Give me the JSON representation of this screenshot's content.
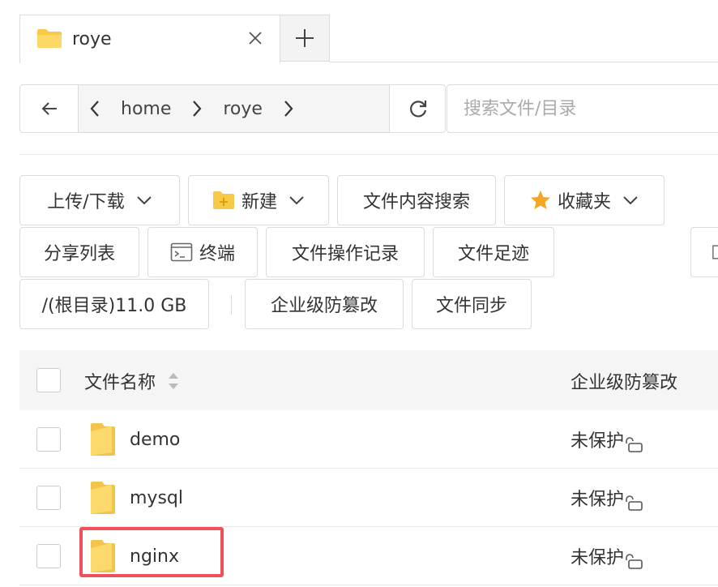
{
  "tabs": [
    {
      "title": "roye",
      "active": true
    }
  ],
  "address": {
    "crumbs": [
      "home",
      "roye"
    ]
  },
  "search": {
    "placeholder": "搜索文件/目录"
  },
  "toolbar": {
    "row1": [
      "上传/下载",
      "新建",
      "文件内容搜索",
      "收藏夹"
    ],
    "row2": [
      "分享列表",
      "终端",
      "文件操作记录",
      "文件足迹"
    ],
    "row3": [
      "/(根目录)11.0 GB",
      "企业级防篡改",
      "文件同步"
    ]
  },
  "table": {
    "headers": {
      "name": "文件名称",
      "protect": "企业级防篡改"
    },
    "rows": [
      {
        "name": "demo",
        "protect": "未保护"
      },
      {
        "name": "mysql",
        "protect": "未保护"
      },
      {
        "name": "nginx",
        "protect": "未保护"
      }
    ]
  },
  "colors": {
    "folder": "#f7c948",
    "highlight": "#f0505a",
    "star": "#f5a623"
  }
}
